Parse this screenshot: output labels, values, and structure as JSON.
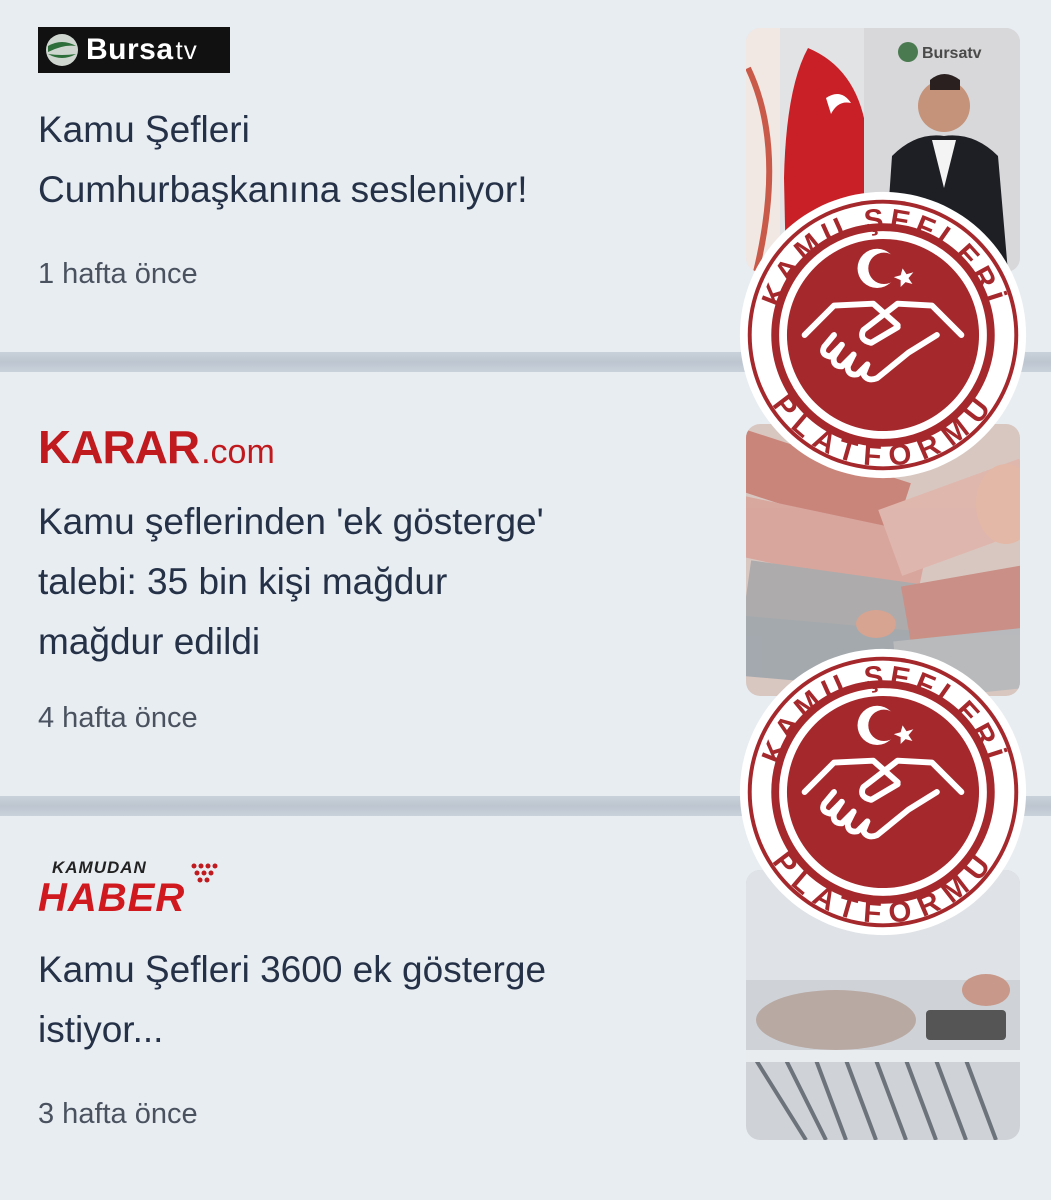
{
  "articles": [
    {
      "source": {
        "name_bold": "Bursa",
        "name_light": "tv"
      },
      "title_line1": "Kamu Şefleri",
      "title_line2": "Cumhurbaşkanına sesleniyor!",
      "time": "1 hafta önce",
      "thumb_logo": "Bursatv"
    },
    {
      "source": {
        "name_bold": "KARAR",
        "name_light": ".com"
      },
      "title_line1": "Kamu şeflerinden 'ek gösterge'",
      "title_line2": "talebi: 35 bin kişi mağdur",
      "title_line3": "mağdur edildi",
      "time": "4 hafta önce"
    },
    {
      "source": {
        "name_top": "KAMUDAN",
        "name_main": "HABER"
      },
      "title_line1": "Kamu Şefleri 3600 ek gösterge",
      "title_line2": "istiyor...",
      "time": "3 hafta önce"
    }
  ],
  "seal": {
    "text_top": "KAMU ŞEFLERİ",
    "text_bottom": "PLATFORMU",
    "icons": [
      "crescent-star-icon",
      "handshake-icon"
    ],
    "colors": {
      "red": "#a5282c",
      "white": "#ffffff"
    }
  }
}
